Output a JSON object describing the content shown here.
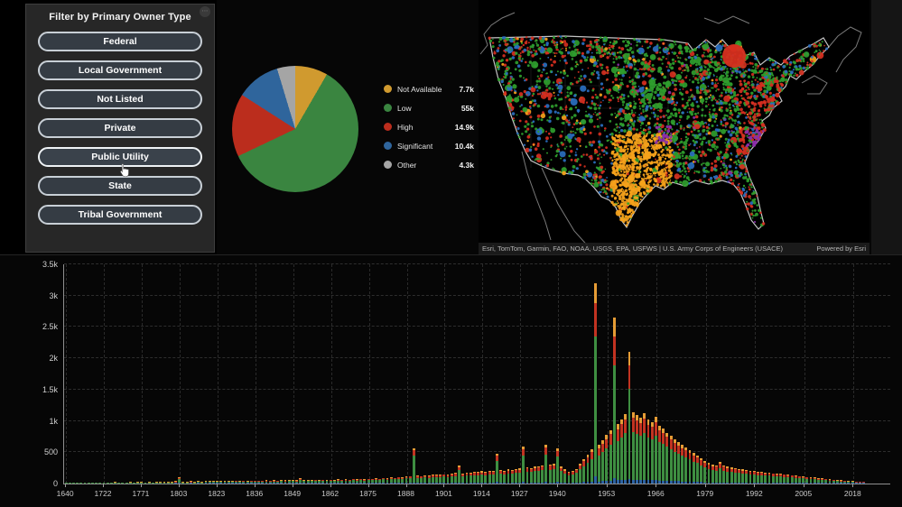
{
  "filter_panel": {
    "title": "Filter by Primary Owner Type",
    "buttons": [
      "Federal",
      "Local Government",
      "Not Listed",
      "Private",
      "Public Utility",
      "State",
      "Tribal Government"
    ],
    "hovered_button": "Public Utility",
    "menu_icon": "panel-options"
  },
  "pie": {
    "legend": [
      {
        "label": "Not Available",
        "value_label": "7.7k",
        "value": 7700,
        "color": "#d09a2f"
      },
      {
        "label": "Low",
        "value_label": "55k",
        "value": 55000,
        "color": "#3a8540"
      },
      {
        "label": "High",
        "value_label": "14.9k",
        "value": 14900,
        "color": "#bb2d1d"
      },
      {
        "label": "Significant",
        "value_label": "10.4k",
        "value": 10400,
        "color": "#2f659c"
      },
      {
        "label": "Other",
        "value_label": "4.3k",
        "value": 4300,
        "color": "#a5a5a5"
      }
    ]
  },
  "map": {
    "attribution": "Esri, TomTom, Garmin, FAO, NOAA, USGS, EPA, USFWS | U.S. Army Corps of Engineers (USACE)",
    "powered_by": "Powered by Esri",
    "dot_colors": {
      "Low": "#2f9e2e",
      "High": "#d62f1f",
      "Significant": "#2a6fc0",
      "Not Available": "#f5a21b",
      "Other": "#8b2fa8"
    },
    "outline_color": "#cfcfcf"
  },
  "chart_data": {
    "type": "bar",
    "stacked": true,
    "xlabel": "",
    "ylabel": "",
    "ylim": [
      0,
      3500
    ],
    "grid": true,
    "yticks": [
      {
        "v": 0,
        "label": "0"
      },
      {
        "v": 500,
        "label": "500"
      },
      {
        "v": 1000,
        "label": "1k"
      },
      {
        "v": 1500,
        "label": "1.5k"
      },
      {
        "v": 2000,
        "label": "2k"
      },
      {
        "v": 2500,
        "label": "2.5k"
      },
      {
        "v": 3000,
        "label": "3k"
      },
      {
        "v": 3500,
        "label": "3.5k"
      }
    ],
    "x_labels_shown": [
      1640,
      1722,
      1771,
      1803,
      1823,
      1836,
      1849,
      1862,
      1875,
      1888,
      1901,
      1914,
      1927,
      1940,
      1953,
      1966,
      1979,
      1992,
      2005,
      2018
    ],
    "series_order": [
      "Significant",
      "Low",
      "High",
      "Not Available"
    ],
    "series_colors": {
      "Significant": "#2e64a5",
      "Low": "#3e8e41",
      "High": "#c23321",
      "Not Available": "#e59c35"
    },
    "bars_format": [
      "year",
      "Significant",
      "Low",
      "High",
      "Not Available"
    ],
    "bars": [
      [
        1640,
        0,
        6,
        0,
        0
      ],
      [
        1648,
        0,
        3,
        1,
        0
      ],
      [
        1656,
        0,
        4,
        0,
        0
      ],
      [
        1664,
        0,
        3,
        1,
        0
      ],
      [
        1672,
        0,
        5,
        1,
        0
      ],
      [
        1680,
        0,
        4,
        0,
        0
      ],
      [
        1688,
        0,
        5,
        1,
        0
      ],
      [
        1696,
        0,
        4,
        1,
        0
      ],
      [
        1704,
        0,
        6,
        1,
        0
      ],
      [
        1713,
        0,
        5,
        1,
        0
      ],
      [
        1722,
        0,
        7,
        1,
        0
      ],
      [
        1727,
        0,
        5,
        1,
        0
      ],
      [
        1732,
        0,
        6,
        1,
        0
      ],
      [
        1737,
        0,
        5,
        1,
        1
      ],
      [
        1742,
        0,
        7,
        1,
        0
      ],
      [
        1747,
        0,
        6,
        2,
        0
      ],
      [
        1752,
        0,
        8,
        2,
        0
      ],
      [
        1757,
        0,
        6,
        1,
        1
      ],
      [
        1762,
        0,
        8,
        2,
        0
      ],
      [
        1766,
        0,
        7,
        2,
        1
      ],
      [
        1771,
        0,
        9,
        2,
        1
      ],
      [
        1774,
        0,
        7,
        2,
        0
      ],
      [
        1777,
        0,
        8,
        2,
        1
      ],
      [
        1780,
        0,
        9,
        2,
        0
      ],
      [
        1783,
        0,
        8,
        3,
        1
      ],
      [
        1786,
        0,
        10,
        2,
        1
      ],
      [
        1789,
        0,
        9,
        3,
        1
      ],
      [
        1792,
        0,
        11,
        3,
        1
      ],
      [
        1795,
        0,
        10,
        3,
        1
      ],
      [
        1799,
        1,
        12,
        3,
        1
      ],
      [
        1803,
        2,
        66,
        14,
        6
      ],
      [
        1805,
        0,
        12,
        3,
        1
      ],
      [
        1807,
        0,
        11,
        3,
        1
      ],
      [
        1809,
        1,
        13,
        3,
        1
      ],
      [
        1811,
        0,
        12,
        4,
        1
      ],
      [
        1813,
        1,
        14,
        4,
        2
      ],
      [
        1815,
        0,
        13,
        4,
        1
      ],
      [
        1817,
        1,
        15,
        4,
        2
      ],
      [
        1819,
        1,
        14,
        4,
        2
      ],
      [
        1821,
        1,
        16,
        5,
        2
      ],
      [
        1823,
        1,
        18,
        5,
        2
      ],
      [
        1824,
        1,
        15,
        4,
        2
      ],
      [
        1826,
        1,
        17,
        5,
        2
      ],
      [
        1827,
        1,
        16,
        5,
        2
      ],
      [
        1829,
        1,
        18,
        5,
        2
      ],
      [
        1830,
        1,
        20,
        6,
        2
      ],
      [
        1831,
        1,
        17,
        5,
        2
      ],
      [
        1833,
        1,
        21,
        6,
        3
      ],
      [
        1834,
        1,
        19,
        6,
        2
      ],
      [
        1835,
        1,
        22,
        6,
        3
      ],
      [
        1836,
        1,
        24,
        7,
        3
      ],
      [
        1837,
        1,
        20,
        6,
        2
      ],
      [
        1839,
        1,
        23,
        7,
        3
      ],
      [
        1840,
        1,
        26,
        7,
        3
      ],
      [
        1841,
        1,
        22,
        7,
        3
      ],
      [
        1842,
        2,
        27,
        8,
        3
      ],
      [
        1844,
        1,
        24,
        7,
        3
      ],
      [
        1845,
        2,
        28,
        8,
        3
      ],
      [
        1847,
        2,
        25,
        8,
        3
      ],
      [
        1848,
        2,
        29,
        9,
        4
      ],
      [
        1849,
        2,
        30,
        9,
        4
      ],
      [
        1850,
        2,
        26,
        8,
        3
      ],
      [
        1852,
        3,
        52,
        13,
        6
      ],
      [
        1853,
        2,
        28,
        9,
        4
      ],
      [
        1854,
        2,
        32,
        10,
        4
      ],
      [
        1856,
        2,
        29,
        9,
        4
      ],
      [
        1857,
        2,
        33,
        10,
        4
      ],
      [
        1858,
        2,
        30,
        10,
        4
      ],
      [
        1860,
        3,
        35,
        11,
        5
      ],
      [
        1861,
        3,
        32,
        10,
        4
      ],
      [
        1862,
        3,
        36,
        11,
        5
      ],
      [
        1863,
        3,
        32,
        10,
        4
      ],
      [
        1865,
        3,
        38,
        12,
        5
      ],
      [
        1866,
        3,
        34,
        11,
        5
      ],
      [
        1867,
        3,
        40,
        12,
        5
      ],
      [
        1869,
        3,
        36,
        12,
        5
      ],
      [
        1870,
        4,
        44,
        13,
        6
      ],
      [
        1871,
        3,
        40,
        12,
        5
      ],
      [
        1873,
        4,
        46,
        14,
        6
      ],
      [
        1874,
        4,
        42,
        13,
        6
      ],
      [
        1875,
        4,
        48,
        14,
        6
      ],
      [
        1876,
        4,
        44,
        13,
        6
      ],
      [
        1878,
        4,
        52,
        15,
        7
      ],
      [
        1879,
        4,
        48,
        14,
        6
      ],
      [
        1880,
        5,
        58,
        17,
        7
      ],
      [
        1882,
        5,
        54,
        16,
        7
      ],
      [
        1883,
        5,
        62,
        18,
        8
      ],
      [
        1884,
        5,
        58,
        17,
        8
      ],
      [
        1886,
        6,
        68,
        20,
        8
      ],
      [
        1887,
        6,
        64,
        19,
        8
      ],
      [
        1888,
        6,
        72,
        21,
        9
      ],
      [
        1890,
        6,
        78,
        23,
        9
      ],
      [
        1892,
        20,
        430,
        88,
        30
      ],
      [
        1893,
        7,
        84,
        25,
        10
      ],
      [
        1894,
        7,
        80,
        24,
        10
      ],
      [
        1895,
        7,
        88,
        26,
        11
      ],
      [
        1896,
        7,
        84,
        25,
        10
      ],
      [
        1897,
        8,
        92,
        27,
        11
      ],
      [
        1899,
        8,
        96,
        28,
        12
      ],
      [
        1900,
        8,
        92,
        28,
        11
      ],
      [
        1901,
        8,
        100,
        30,
        12
      ],
      [
        1902,
        9,
        96,
        29,
        12
      ],
      [
        1904,
        9,
        106,
        31,
        13
      ],
      [
        1905,
        10,
        112,
        33,
        13
      ],
      [
        1906,
        16,
        196,
        52,
        22
      ],
      [
        1907,
        10,
        108,
        32,
        13
      ],
      [
        1909,
        10,
        118,
        35,
        14
      ],
      [
        1910,
        11,
        114,
        34,
        14
      ],
      [
        1912,
        11,
        124,
        37,
        15
      ],
      [
        1913,
        11,
        120,
        36,
        15
      ],
      [
        1914,
        12,
        130,
        38,
        16
      ],
      [
        1915,
        12,
        124,
        37,
        15
      ],
      [
        1917,
        12,
        136,
        40,
        16
      ],
      [
        1918,
        13,
        130,
        39,
        16
      ],
      [
        1920,
        24,
        330,
        86,
        34
      ],
      [
        1921,
        13,
        142,
        42,
        17
      ],
      [
        1922,
        13,
        136,
        41,
        17
      ],
      [
        1924,
        14,
        148,
        44,
        18
      ],
      [
        1925,
        14,
        142,
        43,
        17
      ],
      [
        1926,
        15,
        154,
        46,
        19
      ],
      [
        1927,
        15,
        160,
        48,
        19
      ],
      [
        1928,
        26,
        420,
        104,
        42
      ],
      [
        1930,
        16,
        172,
        51,
        21
      ],
      [
        1931,
        16,
        166,
        49,
        20
      ],
      [
        1932,
        17,
        178,
        53,
        21
      ],
      [
        1934,
        17,
        184,
        55,
        22
      ],
      [
        1935,
        18,
        196,
        58,
        24
      ],
      [
        1936,
        28,
        440,
        112,
        44
      ],
      [
        1938,
        18,
        204,
        61,
        24
      ],
      [
        1939,
        19,
        210,
        62,
        25
      ],
      [
        1940,
        26,
        400,
        100,
        40
      ],
      [
        1941,
        16,
        180,
        54,
        22
      ],
      [
        1942,
        14,
        150,
        45,
        18
      ],
      [
        1943,
        12,
        124,
        37,
        15
      ],
      [
        1944,
        12,
        130,
        39,
        16
      ],
      [
        1945,
        14,
        158,
        47,
        19
      ],
      [
        1946,
        18,
        208,
        62,
        25
      ],
      [
        1947,
        22,
        256,
        77,
        31
      ],
      [
        1948,
        26,
        304,
        91,
        36
      ],
      [
        1949,
        30,
        360,
        108,
        43
      ],
      [
        1950,
        110,
        2240,
        530,
        320
      ],
      [
        1951,
        34,
        410,
        123,
        49
      ],
      [
        1952,
        38,
        460,
        138,
        55
      ],
      [
        1953,
        42,
        515,
        154,
        62
      ],
      [
        1954,
        46,
        570,
        171,
        68
      ],
      [
        1955,
        92,
        1790,
        470,
        298
      ],
      [
        1956,
        52,
        630,
        189,
        76
      ],
      [
        1957,
        56,
        685,
        206,
        82
      ],
      [
        1958,
        60,
        740,
        222,
        89
      ],
      [
        1959,
        78,
        1440,
        375,
        207
      ],
      [
        1960,
        62,
        760,
        228,
        91
      ],
      [
        1961,
        60,
        730,
        219,
        88
      ],
      [
        1962,
        58,
        700,
        210,
        84
      ],
      [
        1963,
        62,
        745,
        224,
        89
      ],
      [
        1964,
        56,
        680,
        204,
        82
      ],
      [
        1965,
        54,
        655,
        197,
        79
      ],
      [
        1966,
        58,
        705,
        212,
        85
      ],
      [
        1967,
        50,
        610,
        183,
        73
      ],
      [
        1968,
        48,
        580,
        174,
        70
      ],
      [
        1969,
        45,
        540,
        162,
        65
      ],
      [
        1970,
        43,
        510,
        153,
        61
      ],
      [
        1971,
        40,
        470,
        141,
        56
      ],
      [
        1972,
        38,
        440,
        132,
        53
      ],
      [
        1973,
        35,
        410,
        123,
        49
      ],
      [
        1974,
        33,
        385,
        116,
        46
      ],
      [
        1975,
        31,
        355,
        107,
        43
      ],
      [
        1976,
        28,
        325,
        98,
        39
      ],
      [
        1977,
        26,
        300,
        90,
        36
      ],
      [
        1978,
        24,
        270,
        81,
        32
      ],
      [
        1979,
        21,
        240,
        72,
        29
      ],
      [
        1980,
        19,
        215,
        65,
        26
      ],
      [
        1981,
        18,
        200,
        60,
        24
      ],
      [
        1982,
        17,
        192,
        58,
        23
      ],
      [
        1983,
        20,
        228,
        68,
        27
      ],
      [
        1984,
        17,
        192,
        58,
        23
      ],
      [
        1985,
        16,
        178,
        53,
        21
      ],
      [
        1986,
        15,
        170,
        51,
        20
      ],
      [
        1987,
        14,
        163,
        49,
        20
      ],
      [
        1988,
        14,
        156,
        47,
        19
      ],
      [
        1989,
        13,
        149,
        45,
        18
      ],
      [
        1990,
        13,
        142,
        43,
        17
      ],
      [
        1991,
        12,
        135,
        41,
        16
      ],
      [
        1992,
        12,
        131,
        39,
        16
      ],
      [
        1993,
        11,
        124,
        37,
        15
      ],
      [
        1994,
        11,
        121,
        36,
        14
      ],
      [
        1995,
        10,
        117,
        35,
        14
      ],
      [
        1996,
        10,
        113,
        34,
        14
      ],
      [
        1997,
        10,
        110,
        33,
        13
      ],
      [
        1998,
        9,
        106,
        32,
        13
      ],
      [
        1999,
        9,
        103,
        31,
        12
      ],
      [
        2000,
        9,
        99,
        30,
        12
      ],
      [
        2001,
        8,
        92,
        28,
        11
      ],
      [
        2002,
        8,
        89,
        27,
        11
      ],
      [
        2003,
        7,
        82,
        25,
        10
      ],
      [
        2004,
        7,
        78,
        23,
        9
      ],
      [
        2005,
        7,
        74,
        22,
        9
      ],
      [
        2006,
        6,
        67,
        20,
        8
      ],
      [
        2007,
        6,
        64,
        19,
        8
      ],
      [
        2008,
        5,
        60,
        18,
        7
      ],
      [
        2009,
        5,
        53,
        16,
        6
      ],
      [
        2010,
        5,
        50,
        15,
        6
      ],
      [
        2011,
        4,
        44,
        13,
        5
      ],
      [
        2012,
        4,
        39,
        12,
        5
      ],
      [
        2013,
        3,
        34,
        10,
        4
      ],
      [
        2014,
        3,
        30,
        9,
        4
      ],
      [
        2015,
        3,
        26,
        8,
        3
      ],
      [
        2016,
        2,
        21,
        6,
        3
      ],
      [
        2017,
        2,
        18,
        5,
        2
      ],
      [
        2018,
        2,
        14,
        4,
        2
      ],
      [
        2019,
        1,
        10,
        3,
        1
      ],
      [
        2020,
        1,
        7,
        2,
        1
      ],
      [
        2021,
        1,
        5,
        1,
        1
      ]
    ]
  }
}
